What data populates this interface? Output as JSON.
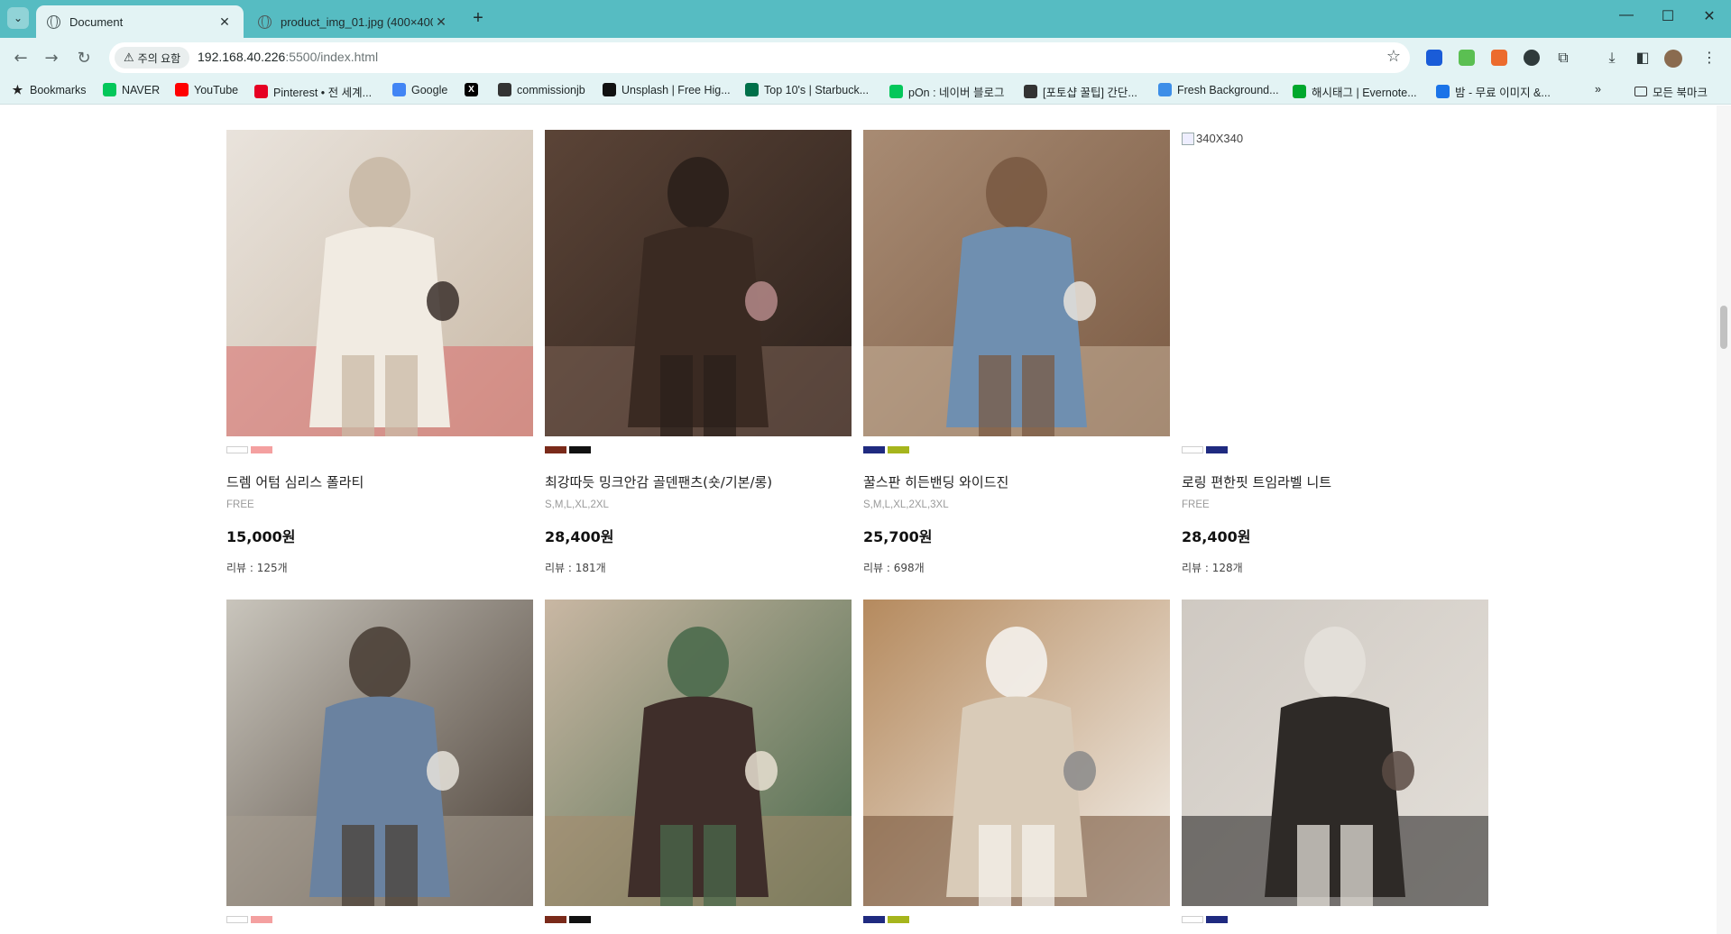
{
  "browser": {
    "tabs": [
      {
        "title": "Document",
        "active": true
      },
      {
        "title": "product_img_01.jpg (400×400)",
        "active": false
      }
    ],
    "window_controls": {
      "minimize": "—",
      "maximize": "☐",
      "close": "✕"
    },
    "security_chip": "주의 요함",
    "url_host": "192.168.40.226",
    "url_rest": ":5500/index.html",
    "bookmarks": [
      {
        "label": "Bookmarks",
        "icon": "star-icon",
        "color": "#222222"
      },
      {
        "label": "NAVER",
        "icon": "naver-icon",
        "color": "#03c75a"
      },
      {
        "label": "YouTube",
        "icon": "youtube-icon",
        "color": "#ff0000"
      },
      {
        "label": "Pinterest • 전 세계...",
        "icon": "pinterest-icon",
        "color": "#e60023"
      },
      {
        "label": "Google",
        "icon": "google-icon",
        "color": "#4285f4"
      },
      {
        "label": "",
        "icon": "x-icon",
        "color": "#000000"
      },
      {
        "label": "commissionjb",
        "icon": "wix-icon",
        "color": "#333333"
      },
      {
        "label": "Unsplash | Free Hig...",
        "icon": "unsplash-icon",
        "color": "#111111"
      },
      {
        "label": "Top 10's | Starbuck...",
        "icon": "starbucks-icon",
        "color": "#00704a"
      },
      {
        "label": "pOn : 네이버 블로그",
        "icon": "blog-icon",
        "color": "#03c75a"
      },
      {
        "label": "[포토샵 꿀팁] 간단...",
        "icon": "dots-icon",
        "color": "#333333"
      },
      {
        "label": "Fresh Background...",
        "icon": "fresh-icon",
        "color": "#3d8ee8"
      },
      {
        "label": "해시태그 | Evernote...",
        "icon": "evernote-icon",
        "color": "#00a82d"
      },
      {
        "label": "밤 - 무료 이미지 &...",
        "icon": "ph-icon",
        "color": "#1a73e8"
      }
    ],
    "bookmarks_overflow": "»",
    "all_bookmarks": "모든 북마크"
  },
  "products": [
    {
      "name": "드렘 어텀 심리스 폴라티",
      "sizes": "FREE",
      "price": "15,000원",
      "reviews": "리뷰 : 125개",
      "swatches": [
        "#ffffff",
        "#f4a0a0"
      ],
      "image": "turtleneck-photo",
      "palette": [
        "#e9e3dc",
        "#f1ebe2",
        "#3a2f2a",
        "#c9b9a6",
        "#d86a6a"
      ]
    },
    {
      "name": "최강따듯 밍크안감 골덴팬츠(숏/기본/롱)",
      "sizes": "S,M,L,XL,2XL",
      "price": "28,400원",
      "reviews": "리뷰 : 181개",
      "swatches": [
        "#7a2a1a",
        "#111111"
      ],
      "image": "corduroy-pants-photo",
      "palette": [
        "#5b4437",
        "#3a2a22",
        "#b5898a",
        "#2b201b",
        "#7b6255"
      ]
    },
    {
      "name": "꿀스판 히든밴딩 와이드진",
      "sizes": "S,M,L,XL,2XL,3XL",
      "price": "25,700원",
      "reviews": "리뷰 : 698개",
      "swatches": [
        "#1f2a80",
        "#a6b51c"
      ],
      "image": "wide-jeans-photo",
      "palette": [
        "#a88b73",
        "#6f8fb0",
        "#e9e4dd",
        "#7a5a43",
        "#c8b29a"
      ]
    },
    {
      "name": "로링 편한핏 트임라벨 니트",
      "sizes": "FREE",
      "price": "28,400원",
      "reviews": "리뷰 : 128개",
      "swatches": [
        "#ffffff",
        "#1f2a80"
      ],
      "image": "broken",
      "alt": "340X340"
    },
    {
      "name": "",
      "sizes": "",
      "price": "",
      "reviews": "",
      "swatches": [
        "#ffffff",
        "#f4a0a0"
      ],
      "image": "blue-shirt-photo",
      "palette": [
        "#c9c5bc",
        "#6a82a0",
        "#e8e4dc",
        "#4b4037",
        "#a89f92"
      ]
    },
    {
      "name": "",
      "sizes": "",
      "price": "",
      "reviews": "",
      "swatches": [
        "#7a2a1a",
        "#111111"
      ],
      "image": "knit-vest-photo",
      "palette": [
        "#c9b7a3",
        "#3f2e2a",
        "#e9e0d2",
        "#4b6a4c",
        "#a58a6c"
      ]
    },
    {
      "name": "",
      "sizes": "",
      "price": "",
      "reviews": "",
      "swatches": [
        "#1f2a80",
        "#a6b51c"
      ],
      "image": "grey-vest-photo",
      "palette": [
        "#b58a5e",
        "#d9cbb8",
        "#8a8a8a",
        "#f4f1ec",
        "#6d4a31"
      ]
    },
    {
      "name": "",
      "sizes": "",
      "price": "",
      "reviews": "",
      "swatches": [
        "#ffffff",
        "#1f2a80"
      ],
      "image": "slacks-photo",
      "palette": [
        "#cfc9c2",
        "#2e2a27",
        "#5a4b44",
        "#e4e0da",
        "#1c1a19"
      ]
    }
  ]
}
